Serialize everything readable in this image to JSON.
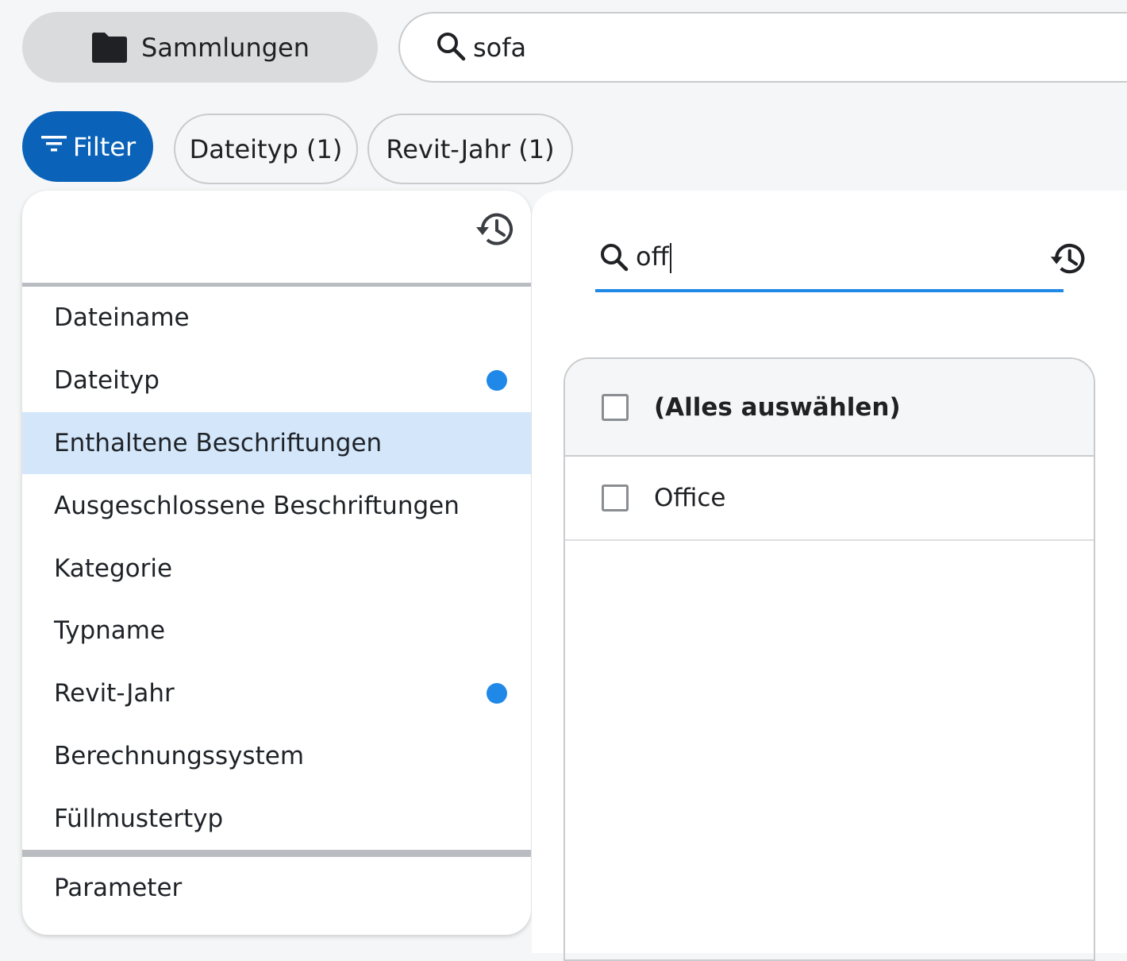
{
  "top_bar": {
    "collections_label": "Sammlungen",
    "search_value": "sofa"
  },
  "filter_row": {
    "filter_label": "Filter",
    "chips": [
      "Dateityp (1)",
      "Revit-Jahr (1)"
    ]
  },
  "filter_categories": {
    "items": [
      {
        "label": "Dateiname"
      },
      {
        "label": "Dateityp"
      },
      {
        "label": "Enthaltene Beschriftungen"
      },
      {
        "label": "Ausgeschlossene Beschriftungen"
      },
      {
        "label": "Kategorie"
      },
      {
        "label": "Typname"
      },
      {
        "label": "Revit-Jahr"
      },
      {
        "label": "Berechnungssystem"
      },
      {
        "label": "Füllmustertyp"
      }
    ],
    "parameter_label": "Parameter",
    "active_item": "Enthaltene Beschriftungen",
    "dotted_items": [
      "Dateityp",
      "Revit-Jahr"
    ]
  },
  "value_panel": {
    "search_value": "off",
    "select_all_label": "(Alles auswählen)",
    "options": [
      {
        "label": "Office",
        "checked": false
      }
    ]
  },
  "colors": {
    "accent": "#0a63b8",
    "dot": "#2089e8",
    "active_row": "#d3e6fa"
  },
  "icons": [
    "folder-icon",
    "search-icon",
    "filter-lines-icon",
    "history-icon"
  ]
}
